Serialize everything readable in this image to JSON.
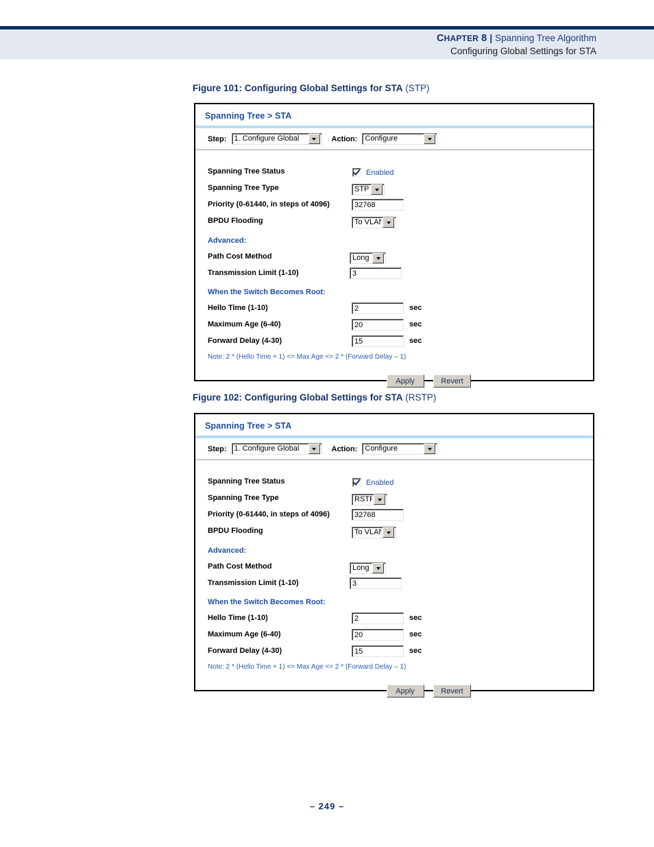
{
  "header": {
    "chapter_label_cap": "C",
    "chapter_label_rest": "HAPTER",
    "chapter_number": "8",
    "separator": "|",
    "chapter_title": "Spanning Tree Algorithm",
    "subtitle": "Configuring Global Settings for STA"
  },
  "footer": {
    "page_number": "–  249  –"
  },
  "figures": [
    {
      "caption_bold": "Figure 101:  Configuring Global Settings for STA",
      "caption_plain": " (STP)",
      "panel": {
        "title": "Spanning Tree > STA",
        "toolbar": {
          "step_label": "Step:",
          "step_value": "1. Configure Global",
          "action_label": "Action:",
          "action_value": "Configure"
        },
        "fields": {
          "status_label": "Spanning Tree Status",
          "status_checkbox_label": "Enabled",
          "status_checked": true,
          "type_label": "Spanning Tree Type",
          "type_value": "STP",
          "priority_label": "Priority (0-61440, in steps of 4096)",
          "priority_value": "32768",
          "bpdu_label": "BPDU Flooding",
          "bpdu_value": "To VLAN",
          "advanced_head": "Advanced:",
          "path_cost_label": "Path Cost Method",
          "path_cost_value": "Long",
          "trans_limit_label": "Transmission Limit (1-10)",
          "trans_limit_value": "3",
          "root_head": "When the Switch Becomes Root:",
          "hello_label": "Hello Time (1-10)",
          "hello_value": "2",
          "hello_unit": "sec",
          "maxage_label": "Maximum Age (6-40)",
          "maxage_value": "20",
          "maxage_unit": "sec",
          "fwddelay_label": "Forward Delay (4-30)",
          "fwddelay_value": "15",
          "fwddelay_unit": "sec",
          "note": "Note: 2 * (Hello Time + 1) <= Max Age <= 2 * (Forward Delay – 1)"
        },
        "buttons": {
          "apply": "Apply",
          "revert": "Revert"
        }
      }
    },
    {
      "caption_bold": "Figure 102:  Configuring Global Settings for STA",
      "caption_plain": " (RSTP)",
      "panel": {
        "title": "Spanning Tree > STA",
        "toolbar": {
          "step_label": "Step:",
          "step_value": "1. Configure Global",
          "action_label": "Action:",
          "action_value": "Configure"
        },
        "fields": {
          "status_label": "Spanning Tree Status",
          "status_checkbox_label": "Enabled",
          "status_checked": true,
          "type_label": "Spanning Tree Type",
          "type_value": "RSTP",
          "priority_label": "Priority (0-61440, in steps of 4096)",
          "priority_value": "32768",
          "bpdu_label": "BPDU Flooding",
          "bpdu_value": "To VLAN",
          "advanced_head": "Advanced:",
          "path_cost_label": "Path Cost Method",
          "path_cost_value": "Long",
          "trans_limit_label": "Transmission Limit (1-10)",
          "trans_limit_value": "3",
          "root_head": "When the Switch Becomes Root:",
          "hello_label": "Hello Time (1-10)",
          "hello_value": "2",
          "hello_unit": "sec",
          "maxage_label": "Maximum Age (6-40)",
          "maxage_value": "20",
          "maxage_unit": "sec",
          "fwddelay_label": "Forward Delay (4-30)",
          "fwddelay_value": "15",
          "fwddelay_unit": "sec",
          "note": "Note: 2 * (Hello Time + 1) <= Max Age <= 2 * (Forward Delay – 1)"
        },
        "buttons": {
          "apply": "Apply",
          "revert": "Revert"
        }
      }
    }
  ]
}
